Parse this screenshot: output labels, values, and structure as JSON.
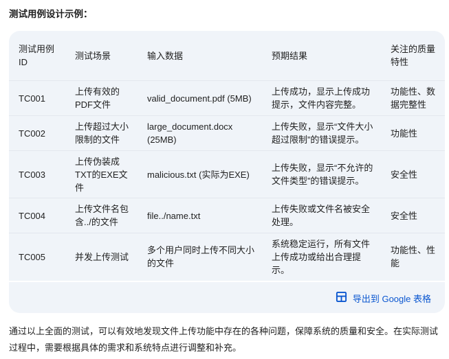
{
  "heading": "测试用例设计示例：",
  "table": {
    "headers": [
      "测试用例ID",
      "测试场景",
      "输入数据",
      "预期结果",
      "关注的质量特性"
    ],
    "rows": [
      [
        "TC001",
        "上传有效的PDF文件",
        "valid_document.pdf (5MB)",
        "上传成功，显示上传成功提示，文件内容完整。",
        "功能性、数据完整性"
      ],
      [
        "TC002",
        "上传超过大小限制的文件",
        "large_document.docx (25MB)",
        "上传失败，显示“文件大小超过限制”的错误提示。",
        "功能性"
      ],
      [
        "TC003",
        "上传伪装成TXT的EXE文件",
        "malicious.txt (实际为EXE)",
        "上传失败，显示“不允许的文件类型”的错误提示。",
        "安全性"
      ],
      [
        "TC004",
        "上传文件名包含../的文件",
        "file../name.txt",
        "上传失败或文件名被安全处理。",
        "安全性"
      ],
      [
        "TC005",
        "并发上传测试",
        "多个用户同时上传不同大小的文件",
        "系统稳定运行，所有文件上传成功或给出合理提示。",
        "功能性、性能"
      ]
    ]
  },
  "export": {
    "label": "导出到 Google 表格",
    "icon": "table-grid-icon"
  },
  "conclusion": "通过以上全面的测试，可以有效地发现文件上传功能中存在的各种问题，保障系统的质量和安全。在实际测试过程中，需要根据具体的需求和系统特点进行调整和补充。",
  "colors": {
    "table_bg": "#f0f4f9",
    "link_blue": "#0b57d0",
    "text": "#1f1f1f"
  }
}
